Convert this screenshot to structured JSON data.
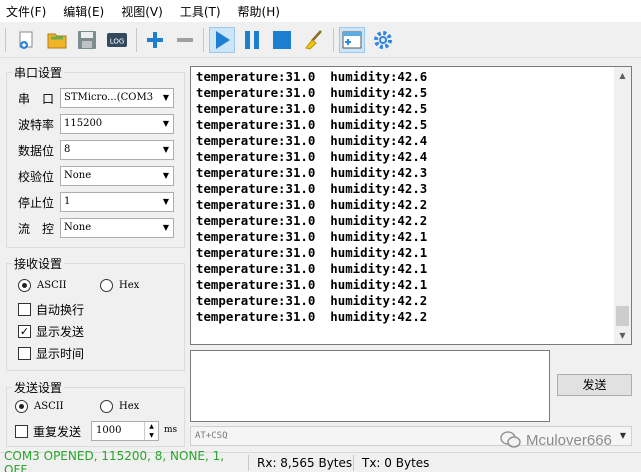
{
  "menu": [
    "文件(F)",
    "编辑(E)",
    "视图(V)",
    "工具(T)",
    "帮助(H)"
  ],
  "toolbar": {
    "log_label": "LOG"
  },
  "serial_group": {
    "title": "串口设置",
    "port": {
      "label": "串　口",
      "value": "STMicro...(COM3"
    },
    "baud": {
      "label": "波特率",
      "value": "115200"
    },
    "databits": {
      "label": "数据位",
      "value": "8"
    },
    "parity": {
      "label": "校验位",
      "value": "None"
    },
    "stopbits": {
      "label": "停止位",
      "value": "1"
    },
    "flow": {
      "label": "流　控",
      "value": "None"
    }
  },
  "recv_group": {
    "title": "接收设置",
    "ascii": "ASCII",
    "hex": "Hex",
    "auto_wrap": "自动换行",
    "show_send": "显示发送",
    "show_time": "显示时间"
  },
  "send_group": {
    "title": "发送设置",
    "ascii": "ASCII",
    "hex": "Hex",
    "repeat": "重复发送",
    "interval": "1000",
    "unit": "ms"
  },
  "receive_lines": [
    "temperature:31.0  humidity:42.6",
    "temperature:31.0  humidity:42.5",
    "temperature:31.0  humidity:42.5",
    "temperature:31.0  humidity:42.5",
    "temperature:31.0  humidity:42.4",
    "temperature:31.0  humidity:42.4",
    "temperature:31.0  humidity:42.3",
    "temperature:31.0  humidity:42.3",
    "temperature:31.0  humidity:42.2",
    "temperature:31.0  humidity:42.2",
    "temperature:31.0  humidity:42.1",
    "temperature:31.0  humidity:42.1",
    "temperature:31.0  humidity:42.1",
    "temperature:31.0  humidity:42.1",
    "temperature:31.0  humidity:42.2",
    "temperature:31.0  humidity:42.2"
  ],
  "send_button": "发送",
  "command_value": "AT+CSQ",
  "status": {
    "port": "COM3 OPENED, 115200, 8, NONE, 1, OFF",
    "rx": "Rx: 8,565 Bytes",
    "tx": "Tx: 0 Bytes"
  },
  "watermark": "Mculover666",
  "colors": {
    "status_ok": "#2aa52a",
    "accent": "#1e7fd0"
  }
}
